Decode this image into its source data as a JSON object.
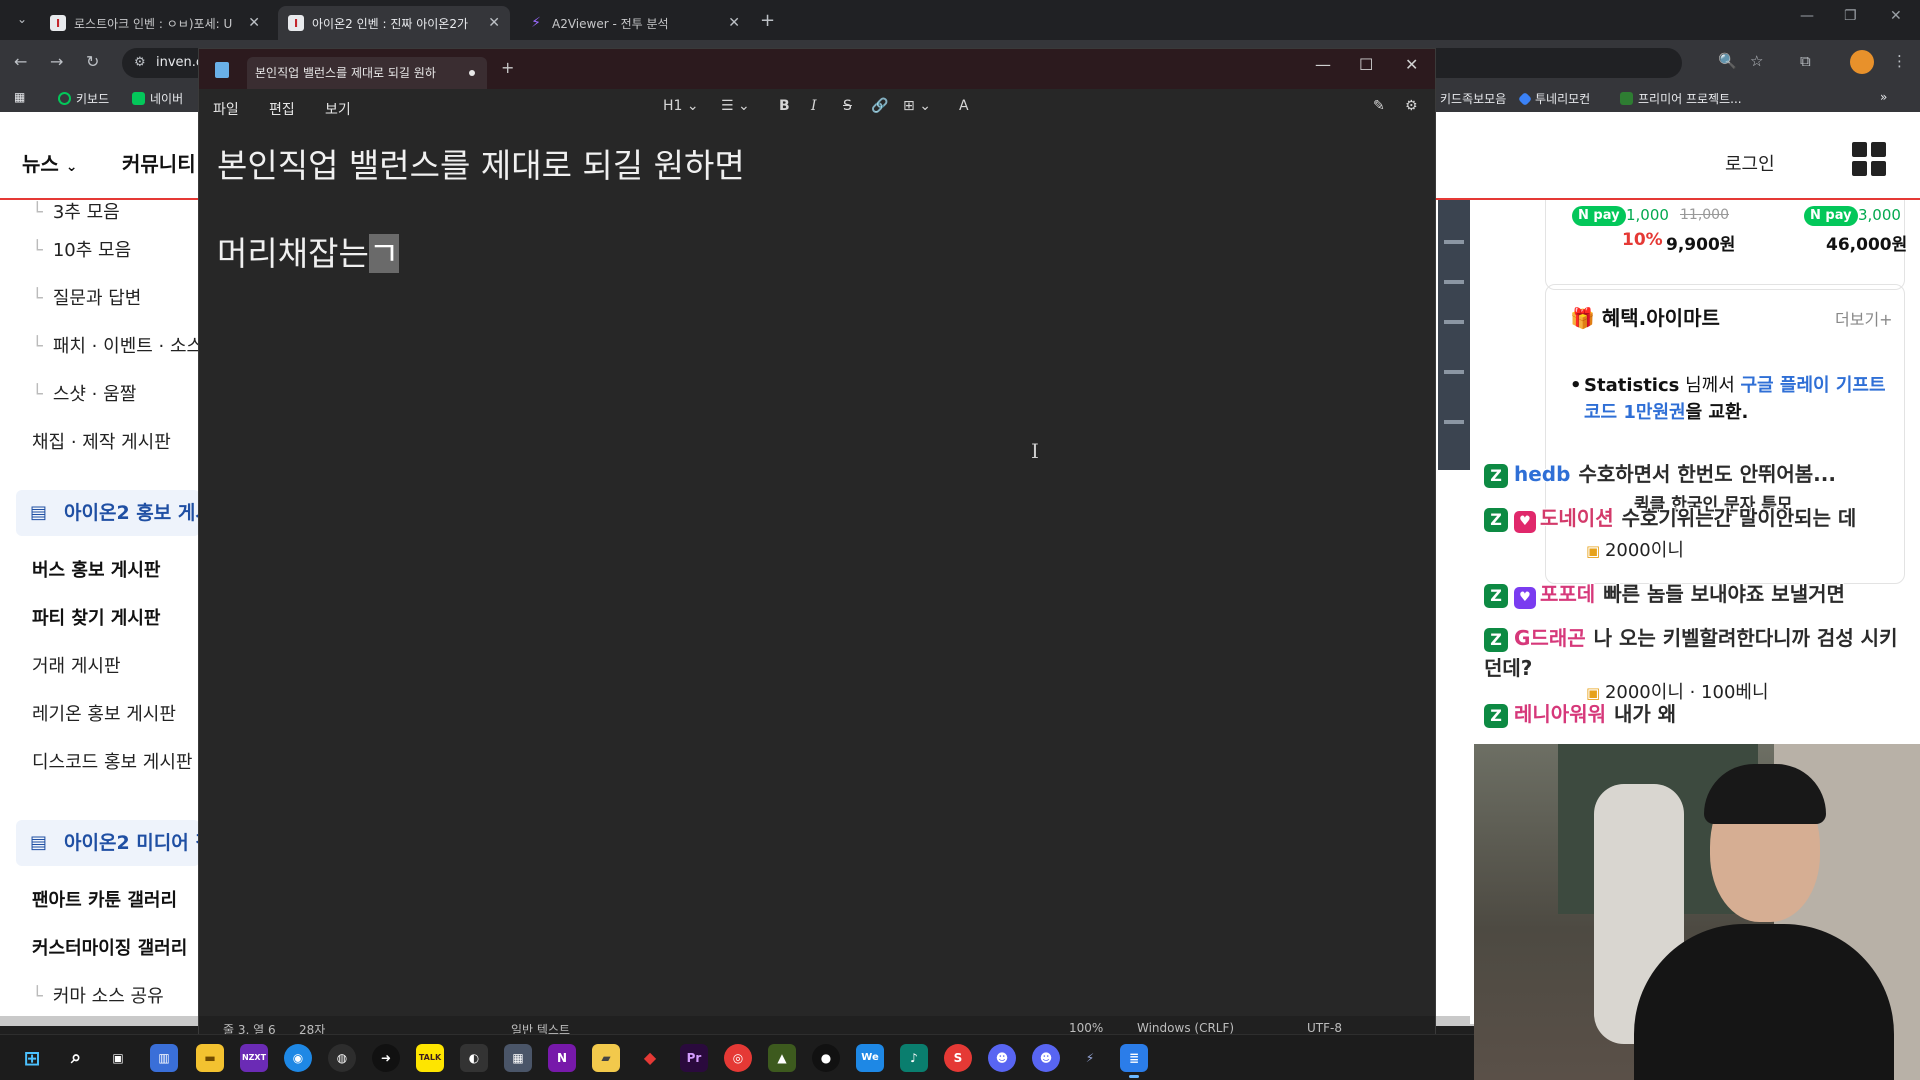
{
  "browser": {
    "tabs": [
      {
        "label": "로스트아크 인벤 : ㅇㅂ)포세: U",
        "active": false
      },
      {
        "label": "아이온2 인벤 : 진짜 아이온2가",
        "active": true
      },
      {
        "label": "A2Viewer - 전투 분석",
        "active": false
      }
    ],
    "address": "inven.c",
    "bookmarks": [
      "키보드",
      "네이버",
      "키드족보모음",
      "투네리모컨",
      "프리미어 프로젝트..."
    ]
  },
  "site": {
    "nav": [
      "뉴스",
      "커뮤니티"
    ],
    "login": "로그인",
    "left_menu": {
      "items_top": [
        "3추 모음",
        "10추 모음",
        "질문과 답변",
        "패치 · 이벤트 · 소스",
        "스샷 · 움짤"
      ],
      "item_craft": "채집 · 제작 게시판",
      "group1": "아이온2 홍보 게시판",
      "group1_items": [
        "버스 홍보 게시판",
        "파티 찾기 게시판",
        "거래 게시판",
        "레기온 홍보 게시판",
        "디스코드 홍보 게시판"
      ],
      "group2": "아이온2 미디어 갤러리",
      "group2_items": [
        "팬아트 카툰 갤러리",
        "커스터마이징 갤러리",
        "커마 소스 공유"
      ]
    },
    "pay": {
      "npay": "N pay",
      "p1_price": "1,000",
      "p1_old": "11,000",
      "p1_pct": "10%",
      "p1_new": "9,900원",
      "p2_price": "3,000",
      "p2_new": "46,000원"
    },
    "benefit": {
      "title": "혜택.아이마트",
      "more": "더보기+",
      "user": "Statistics",
      "mid": " 님께서 ",
      "link": "구글 플레이 기프트 코드 1만원권",
      "end": "을 교환."
    }
  },
  "chat": [
    {
      "nick": "hedb",
      "text": "수호하면서 한번도 안뛰어봄..."
    },
    {
      "nick": "",
      "text": "퀵클 한국인 문자 특모"
    },
    {
      "nick": "도네이션",
      "text": "수호기위는간 말이안되는 데"
    },
    {
      "donate": "2000이니"
    },
    {
      "nick": "포포데",
      "text": "빠른 놈들 보내야죠 보낼거면"
    },
    {
      "nick": "G드래곤",
      "text": "나 오는 키벨할려한다니까 검성 시키던데?"
    },
    {
      "donate": "2000이니 · 100베니"
    },
    {
      "nick": "레니아워워",
      "text": "내가 왜"
    }
  ],
  "notepad": {
    "tab_title": "본인직업 밸런스를 제대로 되길 원하",
    "menu": [
      "파일",
      "편집",
      "보기"
    ],
    "format": {
      "heading": "H1",
      "list": "☰",
      "bold": "B",
      "italic": "I",
      "strike": "S",
      "link": "🔗",
      "table": "⊞",
      "spell": "A"
    },
    "lines": [
      "본인직업 밸런스를 제대로 되길 원하면",
      "머리채잡는"
    ],
    "composing_char": "ㄱ",
    "status": {
      "position": "줄 3, 열 6",
      "chars": "28자",
      "format": "일반 텍스트",
      "zoom": "100%",
      "eol": "Windows (CRLF)",
      "encoding": "UTF-8"
    }
  },
  "taskbar": {
    "icons": [
      "windows-start-icon",
      "search-icon",
      "task-view-icon",
      "widgets-icon",
      "file-explorer-icon",
      "nzxt-icon",
      "app-icon",
      "app-icon",
      "app-icon",
      "kakaotalk-icon",
      "app-icon",
      "calculator-icon",
      "onenote-icon",
      "sticky-notes-icon",
      "app-icon",
      "premiere-icon",
      "chrome-icon",
      "app-icon",
      "app-icon",
      "weverse-icon",
      "tiktok-icon",
      "app-icon",
      "discord-icon",
      "discord-icon",
      "app-icon",
      "notepad-icon"
    ],
    "labels": {
      "nzxt": "NZXT",
      "kakao": "TALK",
      "premiere": "Pr",
      "onenote": "N",
      "weverse": "We",
      "s": "S"
    }
  }
}
